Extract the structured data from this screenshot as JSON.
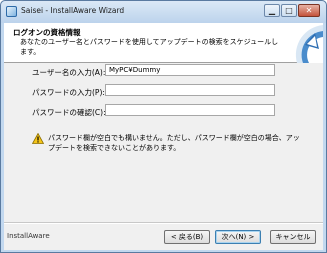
{
  "window": {
    "title": "Saisei - InstallAware Wizard",
    "titlebar_buttons": [
      "minimize-icon",
      "maximize-icon",
      "close-icon"
    ]
  },
  "header": {
    "title": "ログオンの資格情報",
    "description": "あなたのユーザー名とパスワードを使用してアップデートの検索をスケジュールします。"
  },
  "form": {
    "username_label": "ユーザー名の入力(A):",
    "username_value": "MyPC¥Dummy",
    "password_label": "パスワードの入力(P):",
    "password_value": "",
    "confirm_label": "パスワードの確認(C):",
    "confirm_value": ""
  },
  "warning": {
    "icon": "warning-icon",
    "text": "パスワード欄が空白でも構いません。ただし、パスワード欄が空白の場合、アップデートを検索できないことがあります。"
  },
  "footer": {
    "brand": "InstallAware",
    "back_label": "< 戻る(B)",
    "next_label": "次へ(N) >",
    "cancel_label": "キャンセル"
  },
  "colors": {
    "titlebar": "#bcd3ec",
    "header_bg": "#ffffff",
    "dialog_bg": "#f0f0f0",
    "default_button_border": "#3c7fb1",
    "warning_yellow": "#f5c518"
  }
}
